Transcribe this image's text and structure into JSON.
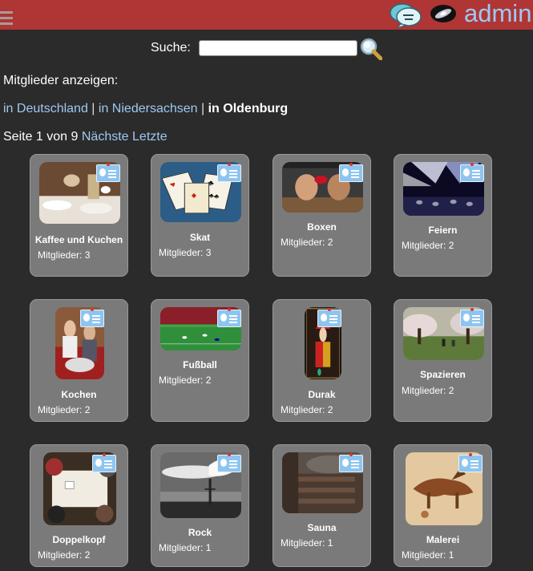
{
  "header": {
    "user": "admin",
    "accent_color": "#b03535",
    "icons": [
      "menu-icon",
      "chat-icon",
      "galaxy-icon"
    ]
  },
  "search": {
    "label": "Suche:",
    "value": "",
    "placeholder": ""
  },
  "members_label": "Mitglieder anzeigen:",
  "regions": {
    "germany": "in Deutschland",
    "lower_saxony": "in Niedersachsen",
    "current": "in Oldenburg",
    "separator": "|"
  },
  "pager": {
    "status": "Seite 1 von 9",
    "next": "Nächste",
    "last": "Letzte"
  },
  "groups": [
    {
      "title": "Kaffee und Kuchen",
      "count": "Mitglieder: 3"
    },
    {
      "title": "Skat",
      "count": "Mitglieder: 3"
    },
    {
      "title": "Boxen",
      "count": "Mitglieder: 2"
    },
    {
      "title": "Feiern",
      "count": "Mitglieder: 2"
    },
    {
      "title": "Kochen",
      "count": "Mitglieder: 2"
    },
    {
      "title": "Fußball",
      "count": "Mitglieder: 2"
    },
    {
      "title": "Durak",
      "count": "Mitglieder: 2"
    },
    {
      "title": "Spazieren",
      "count": "Mitglieder: 2"
    },
    {
      "title": "Doppelkopf",
      "count": "Mitglieder: 2"
    },
    {
      "title": "Rock",
      "count": "Mitglieder: 1"
    },
    {
      "title": "Sauna",
      "count": "Mitglieder: 1"
    },
    {
      "title": "Malerei",
      "count": "Mitglieder: 1"
    }
  ]
}
